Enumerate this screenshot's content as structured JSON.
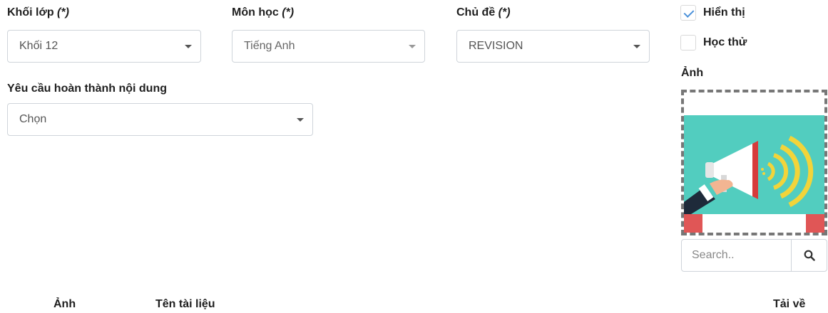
{
  "grade": {
    "label": "Khối lớp",
    "required": "(*)",
    "value": "Khối 12"
  },
  "subject": {
    "label": "Môn học",
    "required": "(*)",
    "value": "Tiếng Anh"
  },
  "topic": {
    "label": "Chủ đề",
    "required": "(*)",
    "value": "REVISION"
  },
  "completion": {
    "label": "Yêu cầu hoàn thành nội dung",
    "value": "Chọn"
  },
  "options": {
    "show_label": "Hiển thị",
    "show_checked": true,
    "trial_label": "Học thử",
    "trial_checked": false
  },
  "image": {
    "label": "Ảnh",
    "picture_icon": "megaphone-icon"
  },
  "search": {
    "placeholder": "Search..",
    "icon": "search-icon"
  },
  "table": {
    "headers": [
      "Ảnh",
      "Tên tài liệu",
      "Tải về"
    ]
  },
  "colors": {
    "image_bg": "#52cdbf",
    "delete_red": "#e05656",
    "check_blue": "#4a90d9"
  }
}
